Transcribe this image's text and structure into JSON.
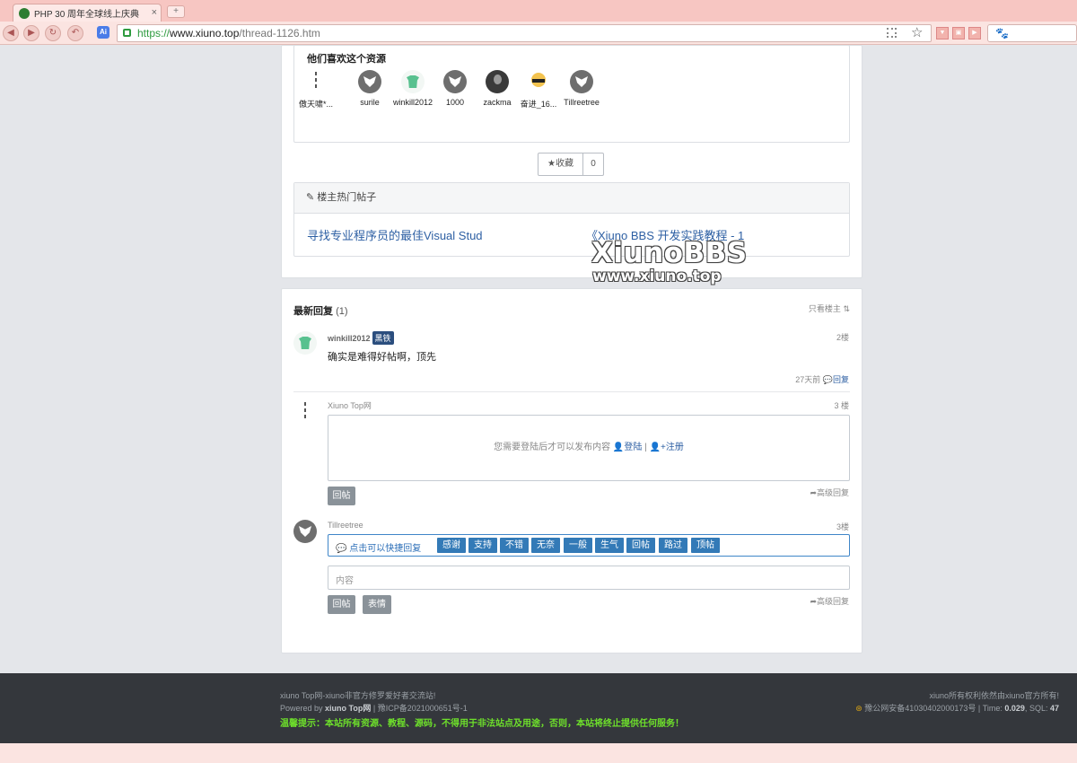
{
  "browser": {
    "tab_title": "PHP 30 周年全球线上庆典",
    "url_scheme": "https://",
    "url_host": "www.xiuno.top",
    "url_path": "/thread-1126.htm"
  },
  "likes": {
    "title": "他们喜欢这个资源",
    "users": [
      {
        "name": "傲天啸*...",
        "avatar": "line-icon"
      },
      {
        "name": "surile",
        "avatar": "wolf-icon"
      },
      {
        "name": "winkill2012",
        "avatar": "shirt-icon"
      },
      {
        "name": "1000",
        "avatar": "wolf-icon"
      },
      {
        "name": "zackma",
        "avatar": "photo-icon"
      },
      {
        "name": "奋进_16...",
        "avatar": "cartoon-icon"
      },
      {
        "name": "Tillreetree",
        "avatar": "wolf-icon"
      }
    ]
  },
  "favorite": {
    "label": "收藏",
    "count": "0"
  },
  "hot_posts": {
    "title": "楼主热门帖子",
    "items": [
      "寻找专业程序员的最佳Visual Stud",
      "《Xiuno BBS 开发实践教程 - 1"
    ]
  },
  "watermark": {
    "title": "XiunoBBS",
    "subtitle": "www.xiuno.top"
  },
  "replies": {
    "title": "最新回复",
    "count": "(1)",
    "only_op": "只看楼主",
    "post1": {
      "user": "winkill2012",
      "badge": "黑铁",
      "floor": "2楼",
      "text": "确实是难得好帖啊，顶先",
      "time": "27天前",
      "reply": "回复"
    },
    "post2": {
      "user": "Xiuno Top网",
      "floor": "3 楼",
      "login_prompt": "您需要登陆后才可以发布内容",
      "login": "登陆",
      "sep": "|",
      "register": "注册",
      "submit": "回帖",
      "advanced": "高级回复"
    },
    "post3": {
      "user": "Tillreetree",
      "floor": "3楼",
      "quick_label": "点击可以快捷回复",
      "quick_buttons": [
        "感谢",
        "支持",
        "不错",
        "无奈",
        "一般",
        "生气",
        "回帖",
        "路过",
        "顶帖"
      ],
      "placeholder": "内容",
      "submit": "回帖",
      "emoji": "表情",
      "advanced": "高级回复"
    }
  },
  "footer": {
    "line1": "xiuno Top网-xiuno非官方修罗爱好者交流站!",
    "powered_prefix": "Powered by",
    "powered_name": "xiuno Top网",
    "icp": "豫ICP备2021000651号-1",
    "warning": "温馨提示：本站所有资源、教程、源码，不得用于非法站点及用途，否则，本站将终止提供任何服务！",
    "rights": "xiuno所有权利依然由xiuno官方所有!",
    "police": "豫公网安备41030402000173号",
    "time_label": "Time:",
    "time_value": "0.029",
    "sql_label": "SQL:",
    "sql_value": "47"
  }
}
